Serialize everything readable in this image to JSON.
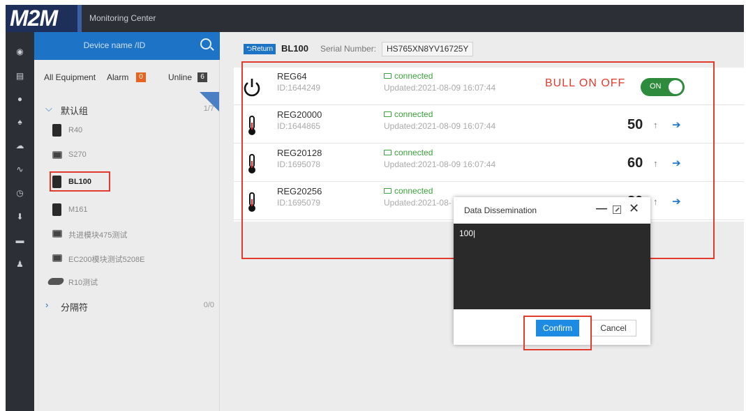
{
  "app": {
    "logo": "M2M",
    "title": "Monitoring Center"
  },
  "rail": [
    "record-icon",
    "list-icon",
    "location-icon",
    "alarm-icon",
    "cloud-icon",
    "trend-icon",
    "clock-icon",
    "download-icon",
    "card-icon",
    "user-icon"
  ],
  "panel": {
    "search_placeholder": "Device name /ID",
    "filters": {
      "all": "All Equipment",
      "alarm": "Alarm",
      "alarm_count": "0",
      "online": "Unline",
      "online_count": "6"
    },
    "groups": [
      {
        "name": "默认组",
        "count": "1/7",
        "expanded": true
      },
      {
        "name": "分隔符",
        "count": "0/0",
        "expanded": false
      }
    ],
    "devices": [
      "R40",
      "S270",
      "BL100",
      "M161",
      "共进模块475测试",
      "EC200模块测试5208E",
      "R10测试"
    ],
    "selected_device": "BL100"
  },
  "main": {
    "return_label": "Return",
    "device_name": "BL100",
    "serial_label": "Serial Number:",
    "serial_value": "HS765XN8YV16725Y",
    "annotation": "BULL ON  OFF",
    "registers": [
      {
        "name": "REG64",
        "id": "ID:1644249",
        "status": "connected",
        "updated": "Updated:2021-08-09 16:07:44",
        "toggle": "ON"
      },
      {
        "name": "REG20000",
        "id": "ID:1644865",
        "status": "connected",
        "updated": "Updated:2021-08-09 16:07:44",
        "value": "50"
      },
      {
        "name": "REG20128",
        "id": "ID:1695078",
        "status": "connected",
        "updated": "Updated:2021-08-09 16:07:44",
        "value": "60"
      },
      {
        "name": "REG20256",
        "id": "ID:1695079",
        "status": "connected",
        "updated": "Updated:2021-08-",
        "value": "80"
      }
    ]
  },
  "dialog": {
    "title": "Data Dissemination",
    "input_value": "100|",
    "confirm": "Confirm",
    "cancel": "Cancel"
  },
  "colors": {
    "accent": "#1d74c6",
    "highlight": "#e23b2e",
    "connected": "#3aa23a",
    "toggle_on": "#2e8b3d"
  }
}
